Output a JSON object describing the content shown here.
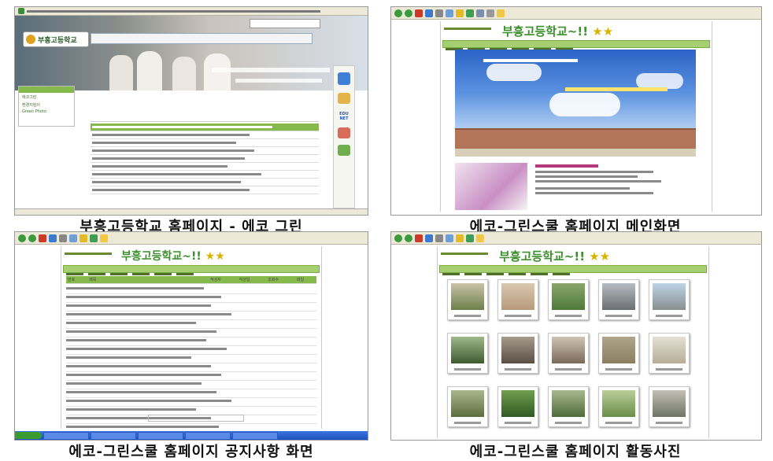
{
  "captions": {
    "top_left": "부흥고등학교 홈페이지 - 에코 그린",
    "top_right": "에코-그린스쿨 홈페이지 메인화면",
    "bottom_left": "에코-그린스쿨 홈페이지 공지사항 화면",
    "bottom_right": "에코-그린스쿨 홈페이지 활동사진"
  },
  "site": {
    "title": "부흥고등학교~!!",
    "stars": "★★",
    "school_logo": "부흥고등학교",
    "left_nav": [
      "에코그린",
      "환경지킴이",
      "Green Photo"
    ],
    "side_banner": "EDU NET"
  },
  "notice_table": {
    "headers": [
      "번호",
      "제목",
      "작성자",
      "작성일",
      "조회수",
      "파일"
    ]
  },
  "colors": {
    "accent_green": "#3c8f2c",
    "nav_green": "#a6cf71",
    "table_header": "#86b94b",
    "sky_blue": "#3f7fd8"
  }
}
